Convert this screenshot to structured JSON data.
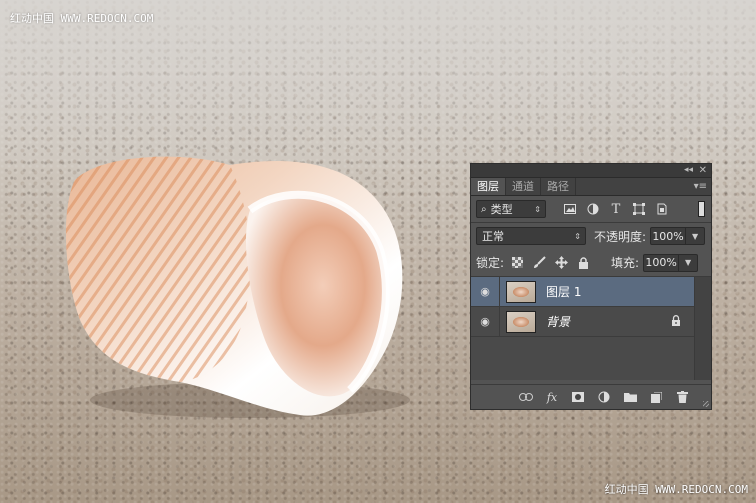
{
  "watermark": {
    "top": "红动中国 WWW.REDOCN.COM",
    "bottom": "红动中国 WWW.REDOCN.COM"
  },
  "panel": {
    "tabs": [
      {
        "label": "图层",
        "active": true
      },
      {
        "label": "通道",
        "active": false
      },
      {
        "label": "路径",
        "active": false
      }
    ],
    "filter": {
      "value": "类型",
      "icons": [
        "image-filter-icon",
        "adjustment-filter-icon",
        "type-filter-icon",
        "shape-filter-icon",
        "smart-object-filter-icon"
      ]
    },
    "blend": {
      "mode": "正常",
      "opacity_label": "不透明度:",
      "opacity_value": "100%"
    },
    "lock": {
      "label": "锁定:",
      "fill_label": "填充:",
      "fill_value": "100%"
    },
    "layers": [
      {
        "name": "图层 1",
        "selected": true,
        "visible": true,
        "locked": false
      },
      {
        "name": "背景",
        "selected": false,
        "visible": true,
        "locked": true
      }
    ],
    "bottom_icons": [
      "link-icon",
      "fx-icon",
      "mask-icon",
      "adjustment-icon",
      "group-folder-icon",
      "new-layer-icon",
      "trash-icon"
    ]
  }
}
